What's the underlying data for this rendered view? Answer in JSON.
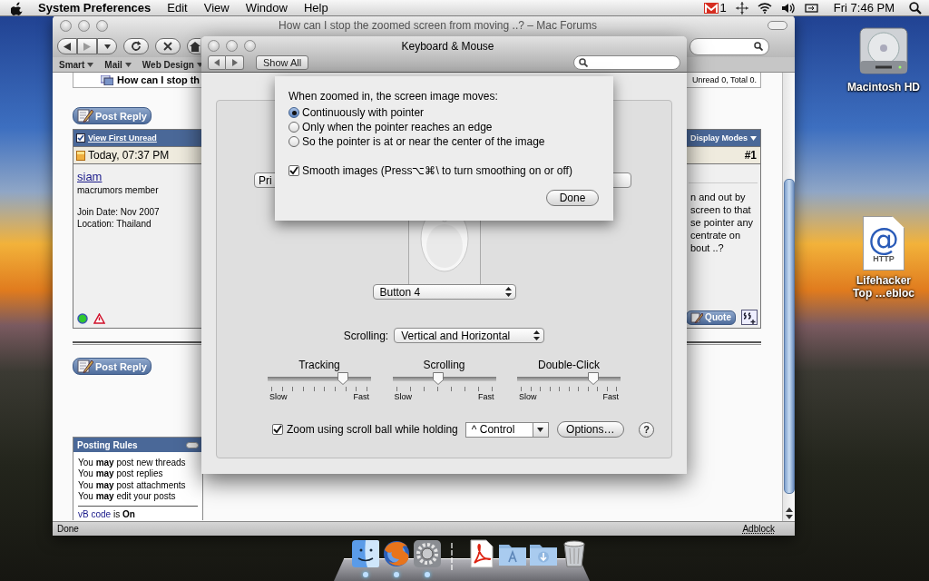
{
  "menubar": {
    "app": "System Preferences",
    "menus": [
      "Edit",
      "View",
      "Window",
      "Help"
    ],
    "mail_count": "1",
    "clock": "Fri 7:46 PM"
  },
  "browser": {
    "title": "How can I stop the zoomed screen from moving ..? – Mac Forums",
    "bookmarks": [
      "Smart",
      "Mail",
      "Web Design"
    ],
    "status": "Done",
    "addon": "Adblock"
  },
  "page": {
    "thread_title": "How can I stop th",
    "thread_stats": "Unread 0, Total 0.",
    "post_reply": [
      "Post Reply",
      "Post Reply"
    ],
    "post": {
      "view_first_unread": "View First Unread",
      "display_modes": "Display Modes",
      "date": "Today, 07:37 PM",
      "number": "#1",
      "username": "siam",
      "user_title": "macrumors member",
      "join_date": "Join Date: Nov 2007",
      "location": "Location: Thailand",
      "online": true,
      "body_lines": [
        "n and out by",
        "screen to that",
        "se pointer any",
        "centrate on",
        "bout ..?"
      ],
      "quote": "Quote"
    },
    "posting_rules": {
      "title": "Posting Rules",
      "rules": [
        "You **may** post new threads",
        "You **may** post replies",
        "You **may** post attachments",
        "You **may** edit your posts"
      ],
      "vb_code_link": "vB code",
      "vb_code_state": "is **On**"
    }
  },
  "prefs": {
    "title": "Keyboard & Mouse",
    "show_all": "Show All",
    "left_popup": "Pri",
    "button_popup": "Button 4",
    "scrolling_label": "Scrolling:",
    "scrolling_popup": "Vertical and Horizontal",
    "sliders": [
      {
        "label": "Tracking",
        "level": 0.75,
        "min": "Slow",
        "max": "Fast"
      },
      {
        "label": "Scrolling",
        "level": 0.44,
        "min": "Slow",
        "max": "Fast"
      },
      {
        "label": "Double-Click",
        "level": 0.76,
        "min": "Slow",
        "max": "Fast"
      }
    ],
    "zoom": {
      "checked": true,
      "label": "Zoom using scroll ball while holding",
      "modifier": "^ Control",
      "options": "Options…",
      "help": "?"
    }
  },
  "sheet": {
    "prompt": "When zoomed in, the screen image moves:",
    "radios": [
      {
        "label": "Continuously with pointer",
        "selected": true
      },
      {
        "label": "Only when the pointer reaches an edge",
        "selected": false
      },
      {
        "label": "So the pointer is at or near the center of the image",
        "selected": false
      }
    ],
    "smooth": {
      "label": "Smooth images (Press⌥⌘\\ to turn smoothing on or off)",
      "checked": true
    },
    "done": "Done"
  },
  "desktop_icons": [
    {
      "kind": "drive",
      "label": "Macintosh HD"
    },
    {
      "kind": "webloc",
      "label": "Lifehacker Top …ebloc",
      "symbol": "@",
      "caption": "HTTP"
    }
  ],
  "dock": [
    {
      "kind": "finder",
      "running": true
    },
    {
      "kind": "browser",
      "running": true
    },
    {
      "kind": "settings",
      "running": true
    },
    {
      "kind": "pdf",
      "running": false
    },
    {
      "kind": "apps-folder",
      "running": false
    },
    {
      "kind": "downloads-folder",
      "running": false
    },
    {
      "kind": "trash",
      "running": false
    }
  ]
}
